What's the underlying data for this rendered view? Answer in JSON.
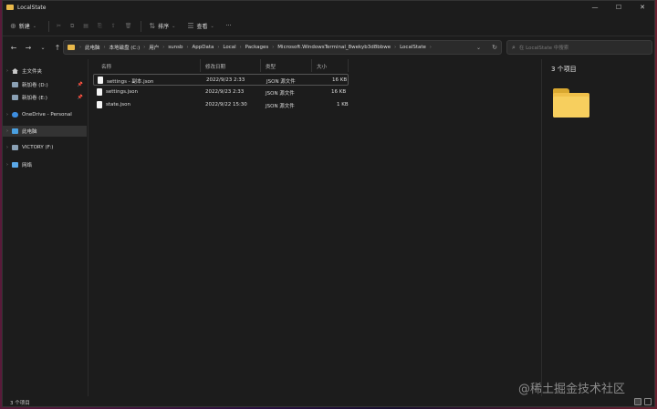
{
  "window": {
    "title": "LocalState",
    "controls": [
      "—",
      "☐",
      "✕"
    ]
  },
  "toolbar": {
    "new_label": "新建",
    "sort_label": "排序",
    "view_label": "查看",
    "more_label": "···"
  },
  "address": {
    "crumbs": [
      "此电脑",
      "本地磁盘 (C:)",
      "用户",
      "sunsb",
      "AppData",
      "Local",
      "Packages",
      "Microsoft.WindowsTerminal_8wekyb3d8bbwe",
      "LocalState"
    ],
    "search_placeholder": "在 LocalState 中搜索"
  },
  "sidebar": {
    "items": [
      {
        "label": "主文件夹"
      },
      {
        "label": "新加卷 (D:)"
      },
      {
        "label": "新加卷 (E:)"
      },
      {
        "label": "OneDrive - Personal"
      },
      {
        "label": "此电脑"
      },
      {
        "label": "VICTORY (F:)"
      },
      {
        "label": "网络"
      }
    ]
  },
  "columns": {
    "name": "名称",
    "date": "修改日期",
    "type": "类型",
    "size": "大小"
  },
  "files": [
    {
      "name": "settings - 副本.json",
      "date": "2022/9/23 2:33",
      "type": "JSON 源文件",
      "size": "16 KB"
    },
    {
      "name": "settings.json",
      "date": "2022/9/23 2:33",
      "type": "JSON 源文件",
      "size": "16 KB"
    },
    {
      "name": "state.json",
      "date": "2022/9/22 15:30",
      "type": "JSON 源文件",
      "size": "1 KB"
    }
  ],
  "details": {
    "count": "3 个项目"
  },
  "status": {
    "count": "3 个项目"
  },
  "watermark": "@稀土掘金技术社区",
  "colors": {
    "folder": "#f0c04a",
    "background": "#1c1c1c"
  }
}
